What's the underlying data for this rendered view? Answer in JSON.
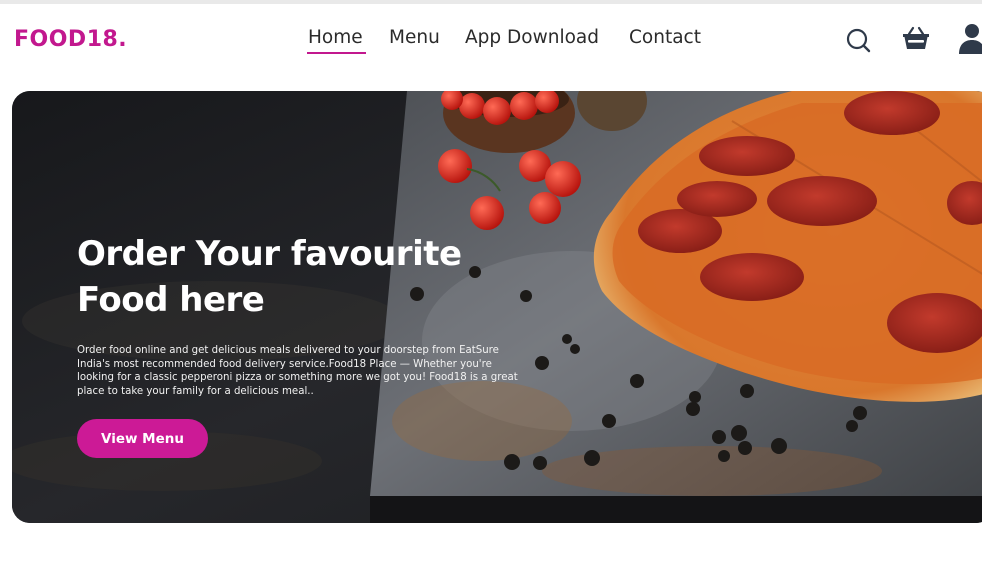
{
  "header": {
    "logo": "FOOD18.",
    "nav": [
      "Home",
      "Menu",
      "App Download",
      "Contact"
    ],
    "active_nav": "Home",
    "icons": [
      "search-icon",
      "basket-icon",
      "user-icon"
    ]
  },
  "hero": {
    "title_line1": "Order Your favourite",
    "title_line2": "Food here",
    "description": "Order food online and get delicious meals delivered to your doorstep from EatSure India's most recommended food delivery service.Food18 Place — Whether you're looking for a classic pepperoni pizza or something more we got you! Food18 is a great place to take your family for a delicious meal..",
    "button_label": "View Menu"
  },
  "colors": {
    "brand": "#c2188e",
    "button": "#cc1a96",
    "icon": "#2f3a4a",
    "hero_dark": "#1d1e22"
  }
}
